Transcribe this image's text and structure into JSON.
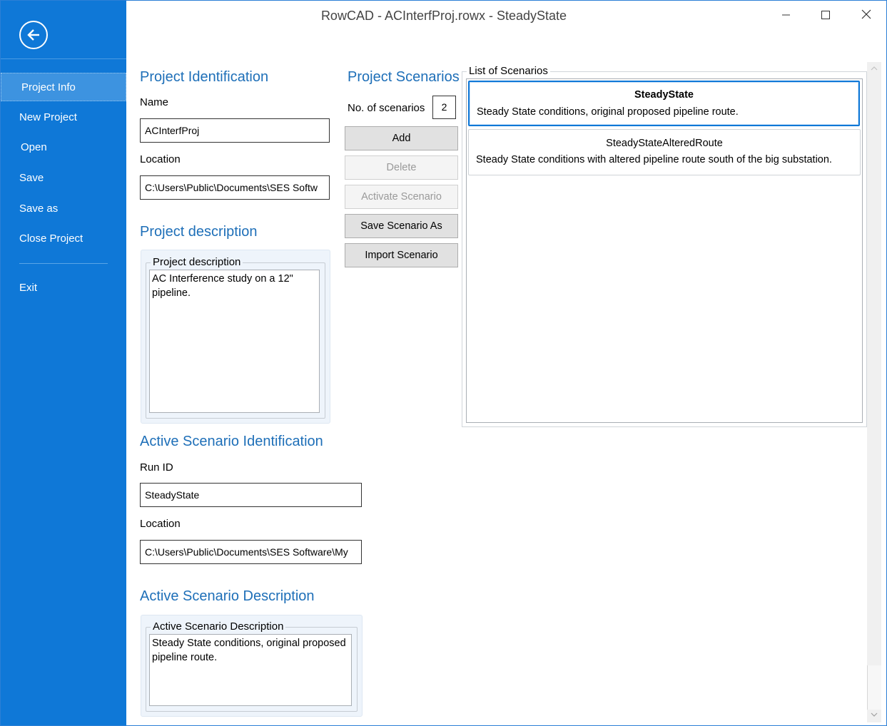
{
  "window": {
    "title": "RowCAD - ACInterfProj.rowx - SteadyState",
    "controls": {
      "minimize_icon": "minimize-icon",
      "maximize_icon": "maximize-icon",
      "close_icon": "close-icon"
    }
  },
  "sidebar": {
    "back_icon": "back-arrow-icon",
    "items": [
      {
        "label": "Project Info",
        "selected": true
      },
      {
        "label": "New Project"
      },
      {
        "label": "Open"
      },
      {
        "label": "Save"
      },
      {
        "label": "Save as"
      },
      {
        "label": "Close Project"
      },
      {
        "label": "Exit"
      }
    ]
  },
  "project_identification": {
    "title": "Project Identification",
    "name_label": "Name",
    "name_value": "ACInterfProj",
    "location_label": "Location",
    "location_value": "C:\\Users\\Public\\Documents\\SES Softw"
  },
  "project_description": {
    "title": "Project description",
    "group_label": "Project description",
    "text": "AC Interference study on a 12\" pipeline."
  },
  "project_scenarios": {
    "title": "Project Scenarios",
    "count_label": "No. of scenarios",
    "count_value": "2",
    "buttons": {
      "add": "Add",
      "delete": "Delete",
      "activate": "Activate Scenario",
      "save_as": "Save Scenario As",
      "import": "Import Scenario"
    }
  },
  "scenario_list": {
    "group_label": "List of Scenarios",
    "items": [
      {
        "name": "SteadyState",
        "description": "Steady State conditions, original proposed pipeline route.",
        "active": true
      },
      {
        "name": "SteadyStateAlteredRoute",
        "description": "Steady State conditions with altered pipeline route south of the big substation.",
        "active": false
      }
    ]
  },
  "active_scenario_identification": {
    "title": "Active Scenario Identification",
    "run_id_label": "Run ID",
    "run_id_value": "SteadyState",
    "location_label": "Location",
    "location_value": "C:\\Users\\Public\\Documents\\SES Software\\My"
  },
  "active_scenario_description": {
    "title": "Active Scenario Description",
    "group_label": "Active Scenario Description",
    "text": "Steady State conditions, original proposed pipeline route."
  },
  "colors": {
    "sidebar": "#0f78d7",
    "sidebar_selected": "#3d93e0",
    "section_title": "#1e6fb8",
    "active_scenario_border": "#0f78d7"
  }
}
